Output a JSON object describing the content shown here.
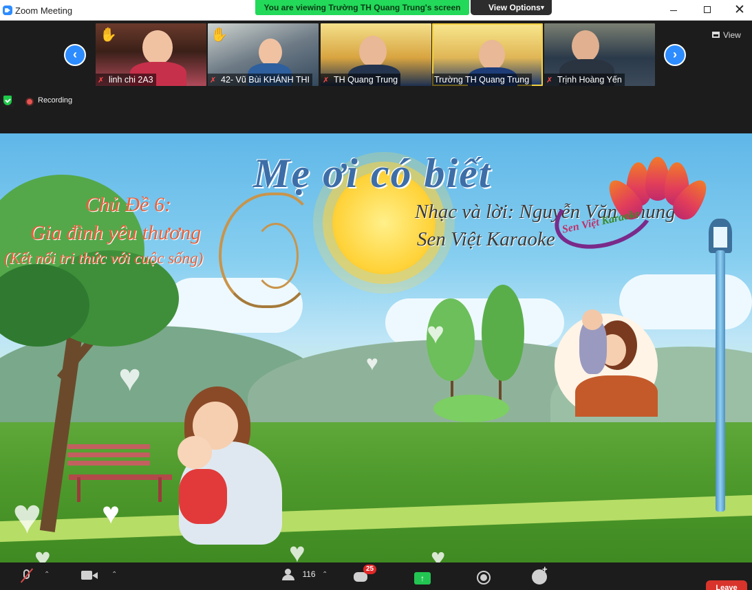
{
  "window": {
    "title": "Zoom Meeting"
  },
  "banner": {
    "viewing_text": "You are viewing Trường TH Quang Trung's screen",
    "view_options_label": "View Options"
  },
  "gallery": {
    "view_label": "View",
    "participants": [
      {
        "name": "linh chi 2A3",
        "hand_raised": true,
        "muted": true
      },
      {
        "name": "42- Vũ Bùi KHÁNH THI",
        "hand_raised": true,
        "muted": true
      },
      {
        "name": "TH Quang Trung",
        "hand_raised": false,
        "muted": true
      },
      {
        "name": "Trường TH Quang Trung",
        "hand_raised": false,
        "muted": false,
        "active_speaker": true
      },
      {
        "name": "Trịnh Hoàng Yến",
        "hand_raised": false,
        "muted": true
      }
    ]
  },
  "status": {
    "recording_label": "Recording"
  },
  "slide": {
    "title": "Mẹ ơi có biết",
    "topic_line1": "Chủ Đề 6:",
    "topic_line2": "Gia đình yêu thương",
    "topic_line3": "(Kết nối tri thức với cuộc sống)",
    "credit_music": "Nhạc và lời: Nguyễn Văn Chung",
    "credit_karaoke": "Sen Việt Karaoke",
    "logo_text_1": "Sen Việt",
    "logo_text_2": "Karaoke"
  },
  "toolbar": {
    "participants_count": "116",
    "chat_badge": "25",
    "leave_label": "Leave"
  },
  "colors": {
    "accent": "#2d8cff",
    "banner_green": "#23d959",
    "leave_red": "#d8342c"
  }
}
